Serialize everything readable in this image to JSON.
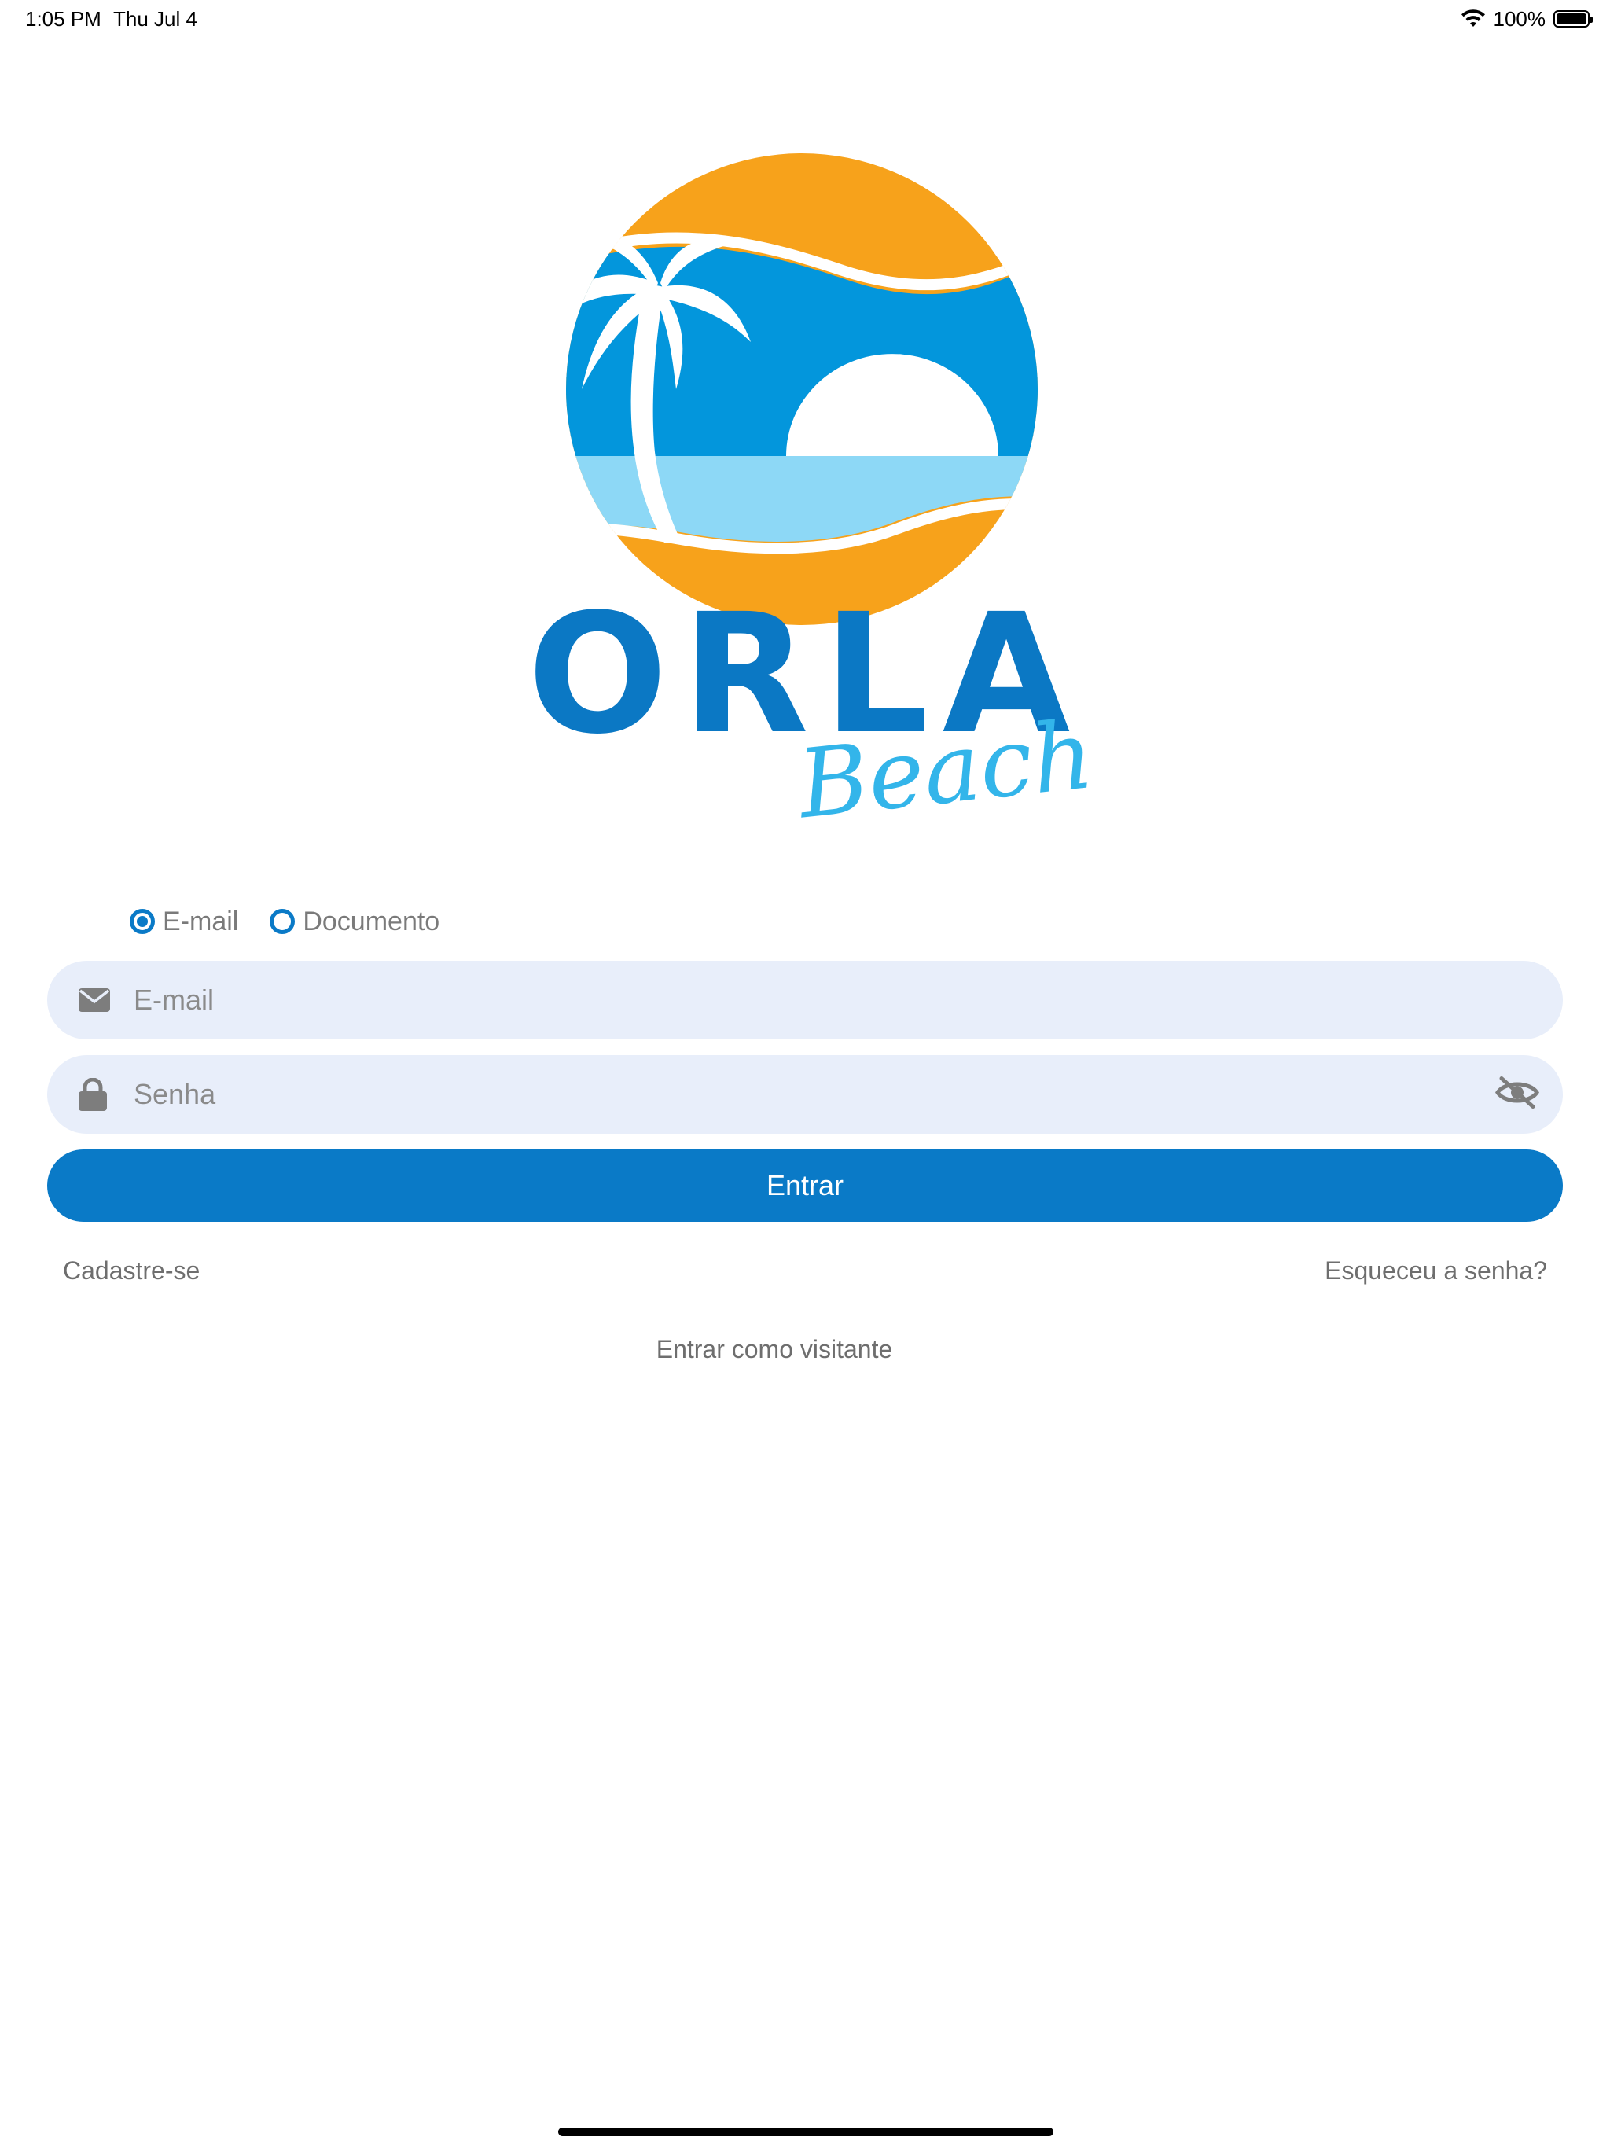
{
  "status_bar": {
    "time": "1:05 PM",
    "date": "Thu Jul 4",
    "battery_percent": "100%",
    "wifi_icon": "wifi-icon",
    "battery_icon": "battery-icon",
    "battery_level": 1.0
  },
  "logo": {
    "wordmark": "ORLA",
    "script": "Beach",
    "colors": {
      "orange": "#F7A21B",
      "blue": "#0396DC",
      "light_blue": "#8DD8F6",
      "wordmark_blue": "#0B78C4",
      "script_blue": "#33B5EA"
    }
  },
  "login_type": {
    "options": [
      {
        "label": "E-mail",
        "selected": true
      },
      {
        "label": "Documento",
        "selected": false
      }
    ]
  },
  "form": {
    "email": {
      "placeholder": "E-mail",
      "value": "",
      "icon": "envelope-icon"
    },
    "password": {
      "placeholder": "Senha",
      "value": "",
      "icon": "lock-icon",
      "toggle_icon": "eye-off-icon"
    },
    "submit_label": "Entrar"
  },
  "links": {
    "signup": "Cadastre-se",
    "forgot_password": "Esqueceu a senha?",
    "guest": "Entrar como visitante"
  },
  "colors": {
    "accent": "#0A7AC7",
    "input_bg": "#E8EEFA",
    "muted_text": "#7A7A7A"
  }
}
